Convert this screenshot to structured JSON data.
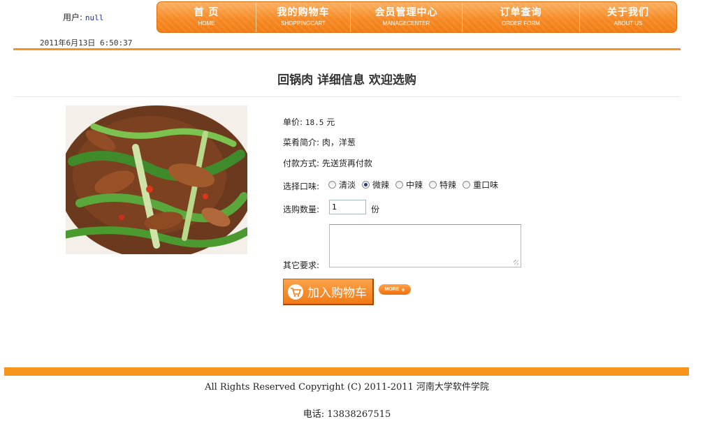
{
  "header": {
    "user_label": "用户:",
    "user_name": "null",
    "datetime": "2011年6月13日 6:50:37"
  },
  "nav": [
    {
      "cn": "首 页",
      "en": "HOME"
    },
    {
      "cn": "我的购物车",
      "en": "SHOPPINGCART"
    },
    {
      "cn": "会员管理中心",
      "en": "MANAGECENTER"
    },
    {
      "cn": "订单查询",
      "en": "ORDER FORM"
    },
    {
      "cn": "关于我们",
      "en": "ABOUT US"
    }
  ],
  "page_title": "回锅肉 详细信息 欢迎选购",
  "product": {
    "price_label": "单价:",
    "price_value": "18.5",
    "price_unit": "元",
    "intro_label": "菜肴简介:",
    "intro_value": "肉，洋葱",
    "payment_label": "付款方式:",
    "payment_value": "先送货再付款",
    "taste_label": "选择口味:",
    "taste_options": [
      "清淡",
      "微辣",
      "中辣",
      "特辣",
      "重口味"
    ],
    "taste_selected": "微辣",
    "qty_label": "选购数量:",
    "qty_value": "1",
    "qty_unit": "份",
    "remark_label": "其它要求:",
    "remark_value": "",
    "add_cart_label": "加入购物车",
    "more_label": "MORE"
  },
  "footer": {
    "copyright": "All Rights Reserved Copyright (C) 2011-2011 河南大学软件学院",
    "phone": "电话: 13838267515"
  },
  "colors": {
    "accent": "#f7941d",
    "nav_dark": "#f27c14",
    "user_name": "#1a2e9a"
  }
}
